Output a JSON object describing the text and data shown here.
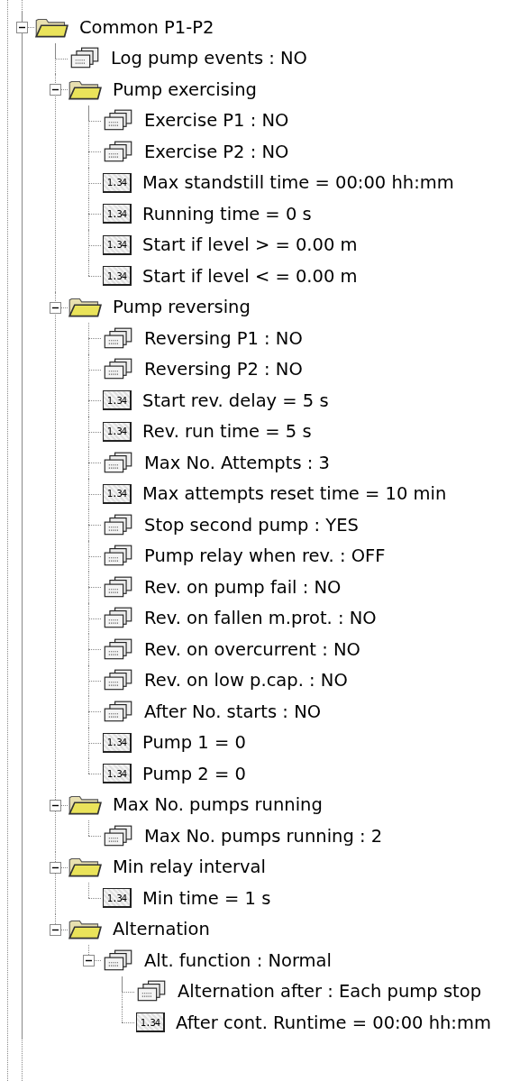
{
  "tree": {
    "label": "Common P1-P2",
    "kind": "folder",
    "expanded": true,
    "children": [
      {
        "label": "Log pump events : NO",
        "kind": "list"
      },
      {
        "label": "Pump exercising",
        "kind": "folder",
        "expanded": true,
        "children": [
          {
            "label": "Exercise P1 : NO",
            "kind": "list"
          },
          {
            "label": "Exercise P2 : NO",
            "kind": "list"
          },
          {
            "label": "Max standstill time = 00:00 hh:mm",
            "kind": "number",
            "icon_text": "1.34"
          },
          {
            "label": "Running time = 0 s",
            "kind": "number",
            "icon_text": "1.34"
          },
          {
            "label": "Start if level > = 0.00 m",
            "kind": "number",
            "icon_text": "1.34"
          },
          {
            "label": "Start if level < = 0.00 m",
            "kind": "number",
            "icon_text": "1.34"
          }
        ]
      },
      {
        "label": "Pump reversing",
        "kind": "folder",
        "expanded": true,
        "children": [
          {
            "label": "Reversing P1 : NO",
            "kind": "list"
          },
          {
            "label": "Reversing P2 : NO",
            "kind": "list"
          },
          {
            "label": "Start rev. delay = 5 s",
            "kind": "number",
            "icon_text": "1.34"
          },
          {
            "label": "Rev. run time = 5 s",
            "kind": "number",
            "icon_text": "1.34"
          },
          {
            "label": "Max No. Attempts : 3",
            "kind": "list"
          },
          {
            "label": "Max attempts reset time = 10 min",
            "kind": "number",
            "icon_text": "1.34"
          },
          {
            "label": "Stop second pump : YES",
            "kind": "list"
          },
          {
            "label": "Pump relay when rev. : OFF",
            "kind": "list"
          },
          {
            "label": "Rev. on pump fail : NO",
            "kind": "list"
          },
          {
            "label": "Rev. on fallen m.prot. : NO",
            "kind": "list"
          },
          {
            "label": "Rev. on overcurrent : NO",
            "kind": "list"
          },
          {
            "label": "Rev. on low p.cap. : NO",
            "kind": "list"
          },
          {
            "label": "After No. starts : NO",
            "kind": "list"
          },
          {
            "label": "Pump 1 = 0",
            "kind": "number",
            "icon_text": "1.34"
          },
          {
            "label": "Pump 2 = 0",
            "kind": "number",
            "icon_text": "1.34"
          }
        ]
      },
      {
        "label": "Max No. pumps running",
        "kind": "folder",
        "expanded": true,
        "children": [
          {
            "label": "Max No. pumps running : 2",
            "kind": "list"
          }
        ]
      },
      {
        "label": "Min relay interval",
        "kind": "folder",
        "expanded": true,
        "children": [
          {
            "label": "Min time = 1 s",
            "kind": "number",
            "icon_text": "1.34"
          }
        ]
      },
      {
        "label": "Alternation",
        "kind": "folder",
        "expanded": true,
        "children": [
          {
            "label": "Alt. function : Normal",
            "kind": "list",
            "expanded": true,
            "children": [
              {
                "label": "Alternation after : Each pump stop",
                "kind": "list"
              },
              {
                "label": "After cont. Runtime = 00:00 hh:mm",
                "kind": "number",
                "icon_text": "1.34"
              }
            ]
          }
        ]
      }
    ]
  }
}
